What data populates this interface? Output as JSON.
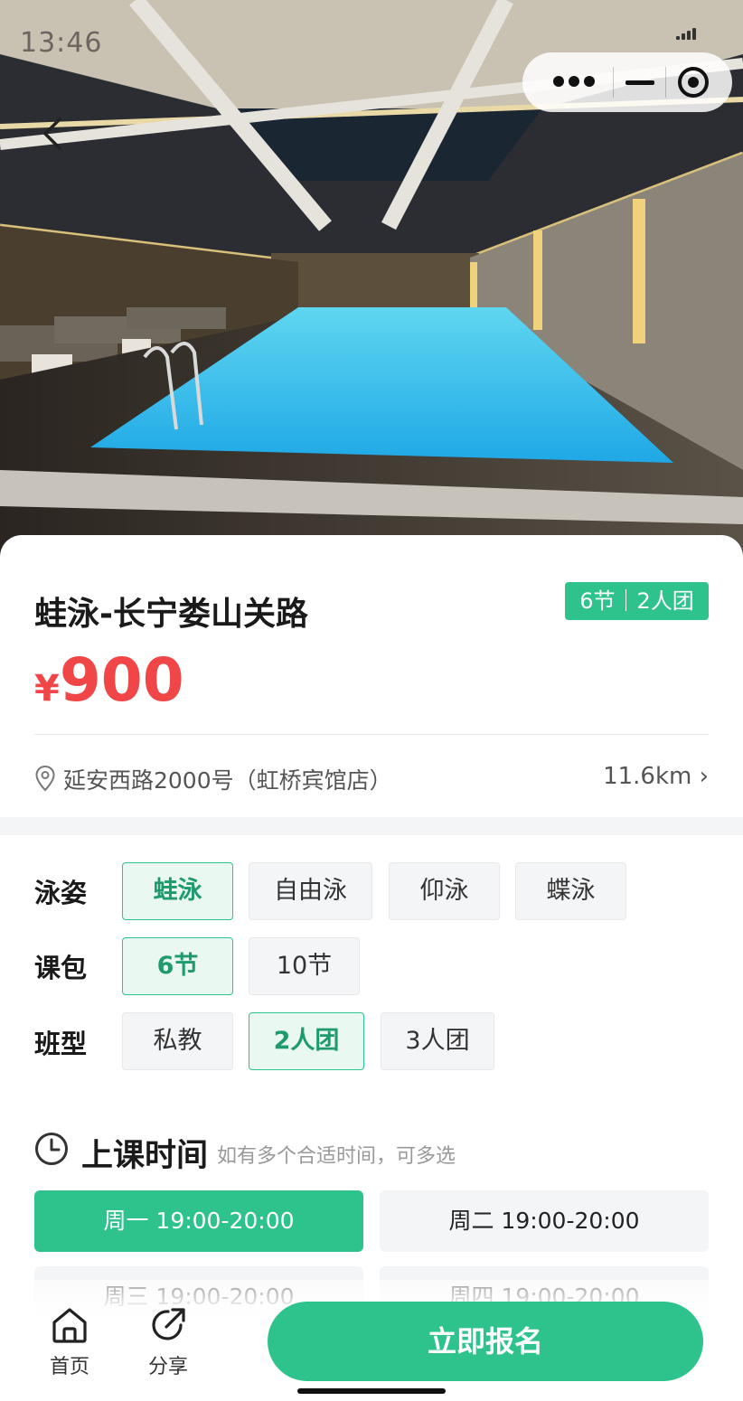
{
  "status_bar": {
    "time": "13:46"
  },
  "hero": {
    "image": "indoor-swimming-pool-photo"
  },
  "course": {
    "title": "蛙泳-长宁娄山关路",
    "tag": "6节｜2人团",
    "price_currency": "¥",
    "price_value": "900",
    "address": "延安西路2000号（虹桥宾馆店）",
    "distance": "11.6km ›"
  },
  "options": {
    "stroke": {
      "label": "泳姿",
      "items": [
        "蛙泳",
        "自由泳",
        "仰泳",
        "蝶泳"
      ],
      "selected": "蛙泳"
    },
    "package": {
      "label": "课包",
      "items": [
        "6节",
        "10节"
      ],
      "selected": "6节"
    },
    "class_type": {
      "label": "班型",
      "items": [
        "私教",
        "2人团",
        "3人团"
      ],
      "selected": "2人团"
    }
  },
  "schedule": {
    "title": "上课时间",
    "hint": "如有多个合适时间，可多选",
    "slots": [
      "周一 19:00-20:00",
      "周二 19:00-20:00",
      "周三 19:00-20:00",
      "周四 19:00-20:00"
    ],
    "selected": "周一 19:00-20:00"
  },
  "bottom_bar": {
    "home_label": "首页",
    "share_label": "分享",
    "signup_label": "立即报名"
  },
  "colors": {
    "accent": "#2ec28c",
    "price": "#f04648"
  }
}
